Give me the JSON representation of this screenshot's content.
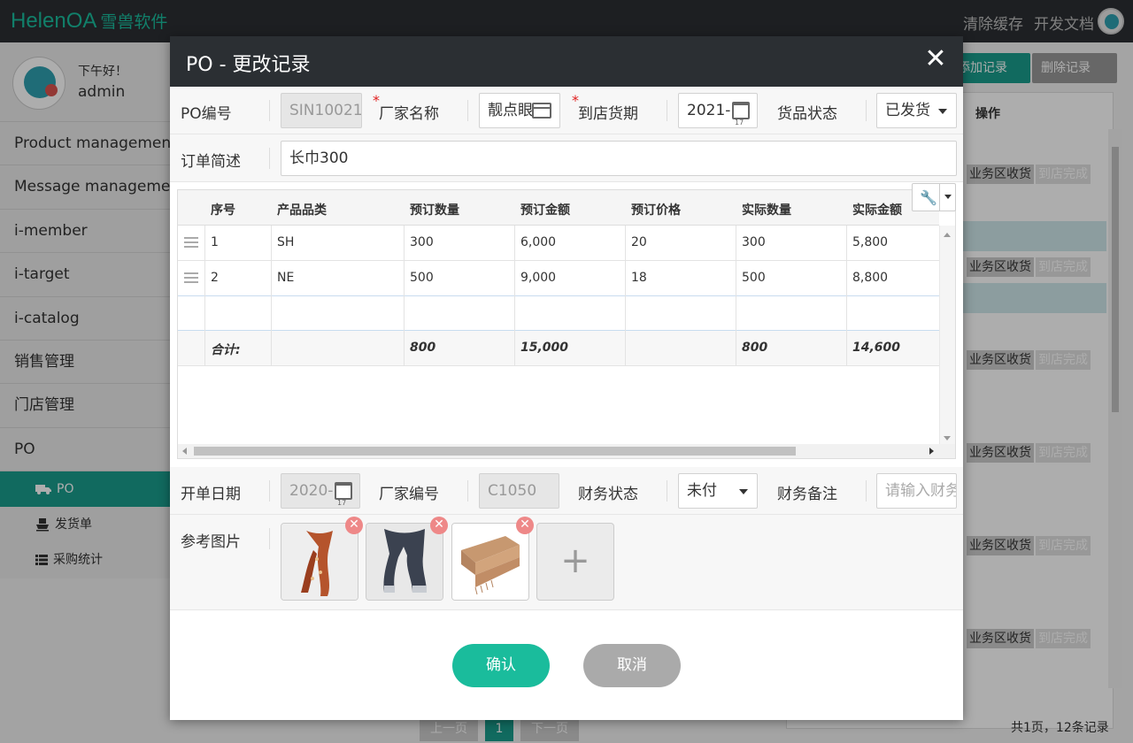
{
  "app": {
    "brand": "HelenOA",
    "brand_sub": "雪兽软件",
    "links": [
      "清除缓存",
      "开发文档"
    ]
  },
  "user": {
    "greeting": "下午好！",
    "name": "admin"
  },
  "sidebar": {
    "items": [
      "Product management",
      "Message management",
      "i-member",
      "i-target",
      "i-catalog",
      "销售管理",
      "门店管理",
      "PO"
    ],
    "sub_items": [
      {
        "icon": "truck-icon",
        "label": "PO",
        "active": true
      },
      {
        "icon": "ship-icon",
        "label": "发货单",
        "active": false
      },
      {
        "icon": "list-icon",
        "label": "采购统计",
        "active": false
      }
    ]
  },
  "background": {
    "add_label": "添加记录",
    "delete_label": "删除记录",
    "col_action": "操作",
    "row_actions": [
      "业务区收货",
      "到店完成"
    ],
    "pager": {
      "prev": "上一页",
      "page": "1",
      "next": "下一页"
    },
    "footer": "共1页，12条记录"
  },
  "modal": {
    "title": "PO - 更改记录",
    "fields": {
      "po_no": {
        "label": "PO编号",
        "value": "SIN10021"
      },
      "vendor_name": {
        "label": "厂家名称",
        "value": "靓点眼"
      },
      "arrival_date": {
        "label": "到店货期",
        "value": "2021-"
      },
      "goods_status": {
        "label": "货品状态",
        "value": "已发货"
      },
      "order_desc": {
        "label": "订单简述",
        "value": "长巾300"
      },
      "open_date": {
        "label": "开单日期",
        "value": "2020-"
      },
      "vendor_code": {
        "label": "厂家编号",
        "value": "C1050"
      },
      "finance_status": {
        "label": "财务状态",
        "value": "未付"
      },
      "finance_note": {
        "label": "财务备注",
        "placeholder": "请输入财务"
      },
      "ref_images": {
        "label": "参考图片"
      }
    },
    "grid": {
      "columns": [
        "序号",
        "产品品类",
        "预订数量",
        "预订金额",
        "预订价格",
        "实际数量",
        "实际金额"
      ],
      "rows": [
        [
          "1",
          "SH",
          "300",
          "6,000",
          "20",
          "300",
          "5,800"
        ],
        [
          "2",
          "NE",
          "500",
          "9,000",
          "18",
          "500",
          "8,800"
        ]
      ],
      "total": {
        "label": "合计:",
        "qty": "800",
        "amount": "15,000",
        "actual_qty": "800",
        "actual_amount": "14,600"
      }
    },
    "confirm_label": "确认",
    "cancel_label": "取消"
  },
  "colors": {
    "accent": "#1abc9c",
    "header_bg": "#2b2f33",
    "active_nav": "#1a9c8c"
  }
}
